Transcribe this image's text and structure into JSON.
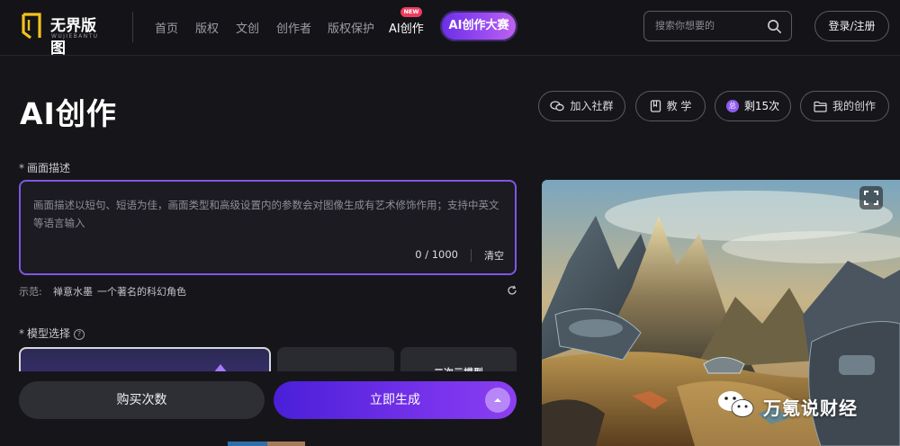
{
  "brand": {
    "name": "无界版图",
    "sub": "WUJIEBANTU"
  },
  "nav": {
    "links": [
      "首页",
      "版权",
      "文创",
      "创作者",
      "版权保护",
      "AI创作"
    ],
    "new_badge": "NEW",
    "contest": "AI创作大赛",
    "search_placeholder": "搜索你想要的",
    "login": "登录/注册"
  },
  "header": {
    "title": "AI创作",
    "actions": {
      "community": "加入社群",
      "tutorial": "教 学",
      "credits": "剩15次",
      "credit_badge": "总",
      "my_works": "我的创作"
    }
  },
  "prompt": {
    "required_mark": "*",
    "label": "画面描述",
    "placeholder": "画面描述以短句、短语为佳，画面类型和高级设置内的参数会对图像生成有艺术修饰作用；支持中英文等语言输入",
    "counter": "0 / 1000",
    "clear": "清空",
    "examples_label": "示范:",
    "examples": [
      "禅意水墨",
      "一个著名的科幻角色"
    ]
  },
  "models": {
    "label": "模型选择",
    "help": "?",
    "items": [
      {
        "name": "",
        "selected": true
      },
      {
        "name": "",
        "selected": false
      },
      {
        "name": "二次元模型",
        "selected": false
      }
    ]
  },
  "actions": {
    "buy": "购买次数",
    "generate": "立即生成"
  },
  "watermark": {
    "text": "万氪说财经"
  },
  "colors": {
    "accent": "#7f55e6",
    "contest": "#9b4cf0",
    "badge": "#ee3d5e",
    "bg": "#16161a"
  }
}
